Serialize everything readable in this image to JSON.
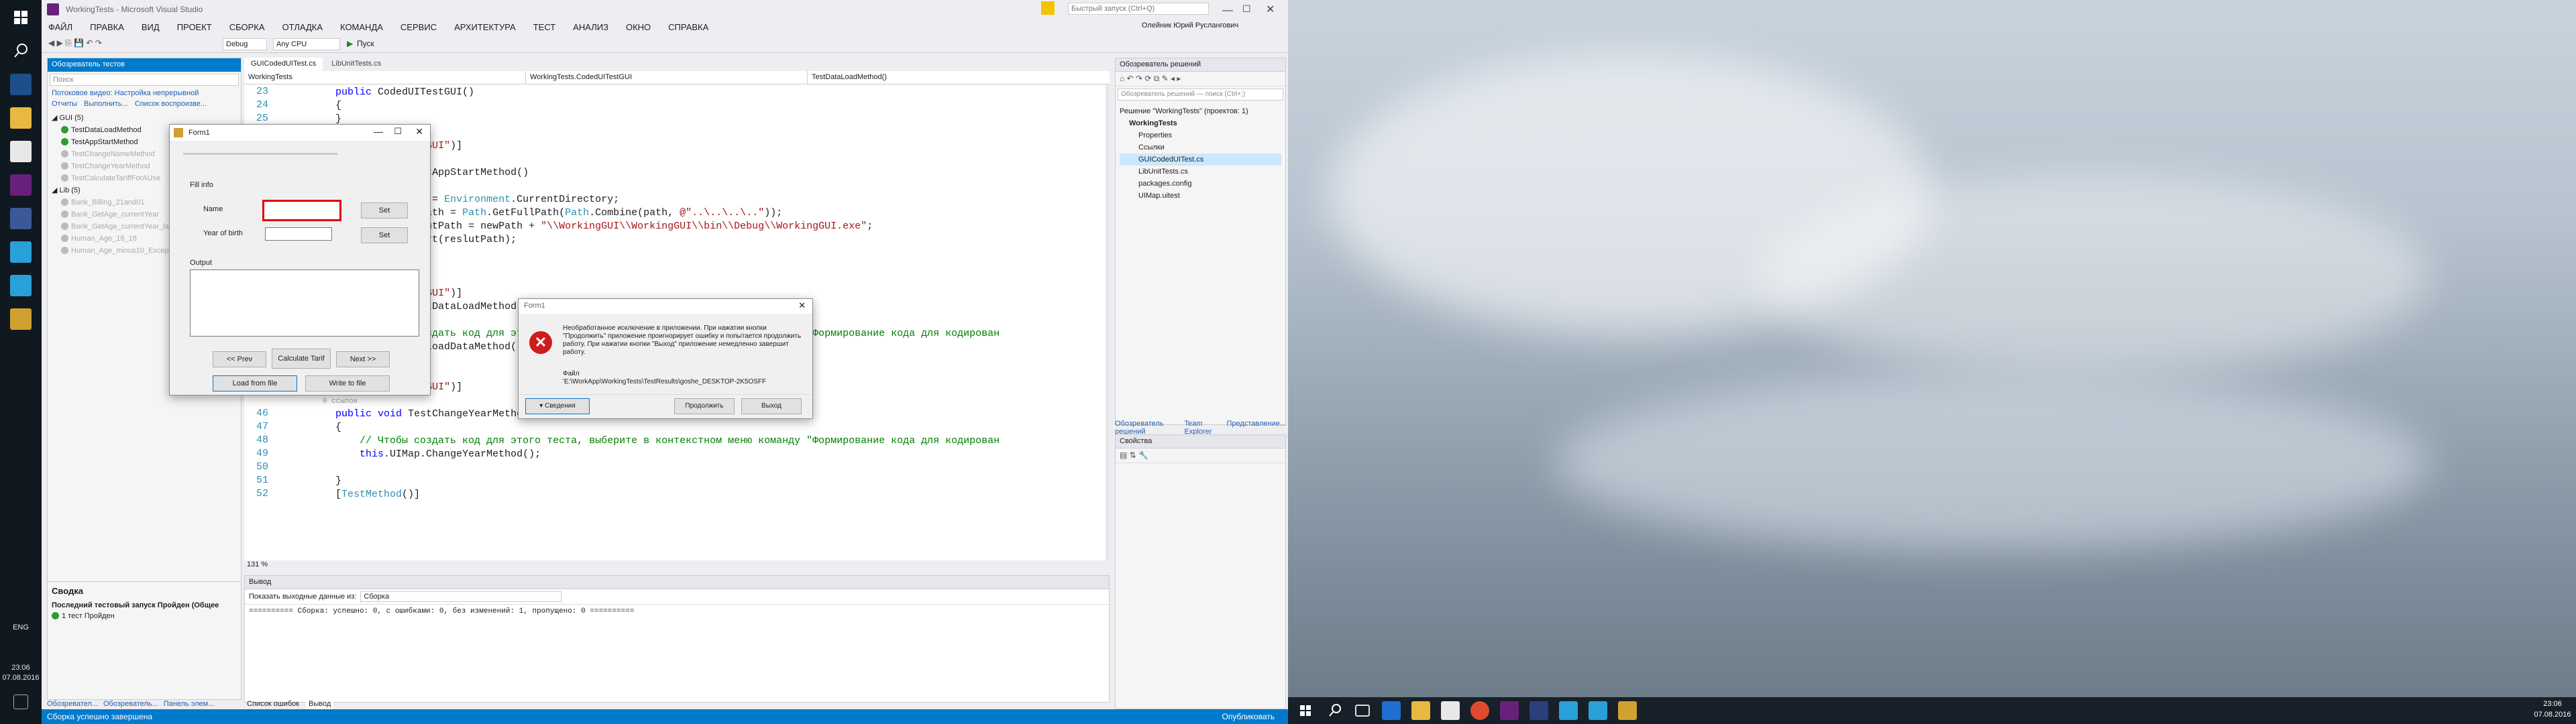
{
  "vs": {
    "title": "WorkingTests - Microsoft Visual Studio",
    "quick_launch_placeholder": "Быстрый запуск (Ctrl+Q)",
    "user": "Олейник Юрий Руслангович",
    "menu": [
      "ФАЙЛ",
      "ПРАВКА",
      "ВИД",
      "ПРОЕКТ",
      "СБОРКА",
      "ОТЛАДКА",
      "КОМАНДА",
      "СЕРВИС",
      "АРХИТЕКТУРА",
      "ТЕСТ",
      "АНАЛИЗ",
      "ОКНО",
      "СПРАВКА"
    ],
    "toolbar": {
      "config": "Debug",
      "platform": "Any CPU",
      "start": "Пуск"
    },
    "test_explorer": {
      "title": "Обозреватель тестов",
      "search_placeholder": "Поиск",
      "stream": "Потоковое видео: Настройка непрерывной",
      "group_label": "Отчеты",
      "run_label": "Выполнить...",
      "playlist_label": "Список воспроизве...",
      "groups": [
        {
          "name": "GUI (5)",
          "items": [
            "TestDataLoadMethod",
            "TestAppStartMethod",
            "TestChangeNameMethod",
            "TestChangeYearMethod",
            "TestCalculateTariffForAUse"
          ]
        },
        {
          "name": "Lib (5)",
          "items": [
            "Bank_Billing_21and01",
            "Bank_GetAge_currentYear",
            "Bank_GetAge_currentYear_la",
            "Human_Age_18_18",
            "Human_Age_minus10_Excep"
          ]
        }
      ],
      "summary_title": "Сводка",
      "summary_last": "Последний тестовый запуск Пройден (Общее",
      "summary_passed": "1 тест Пройден"
    },
    "tabs": [
      "GUICodedUITest.cs",
      "LibUnitTests.cs"
    ],
    "nav": {
      "project": "WorkingTests",
      "class": "WorkingTests.CodedUITestGUI",
      "member": "TestDataLoadMethod()"
    },
    "code": [
      {
        "n": "23",
        "t": "        public CodedUITestGUI()"
      },
      {
        "n": "24",
        "t": "        {"
      },
      {
        "n": "25",
        "t": "        }"
      },
      {
        "n": "",
        "t": "        [TestMethod()]"
      },
      {
        "n": "",
        "t": "        [TestCategory(\"GUI\")]"
      },
      {
        "n": "",
        "t": ""
      },
      {
        "n": "",
        "t": "        public void TestAppStartMethod()"
      },
      {
        "n": "",
        "t": "        {"
      },
      {
        "n": "",
        "t": "            string path = Environment.CurrentDirectory;"
      },
      {
        "n": "",
        "t": "            string newPath = Path.GetFullPath(Path.Combine(path, @\"..\\..\\..\\..\"));"
      },
      {
        "n": "",
        "t": "            string reslutPath = newPath + \"\\\\WorkingGUI\\\\WorkingGUI\\\\bin\\\\Debug\\\\WorkingGUI.exe\";"
      },
      {
        "n": "",
        "t": "            Process.Start(reslutPath);"
      },
      {
        "n": "",
        "t": "        }"
      },
      {
        "n": "",
        "t": ""
      },
      {
        "n": "",
        "t": "        [TestMethod()]"
      },
      {
        "n": "",
        "t": "        [TestCategory(\"GUI\")]"
      },
      {
        "n": "",
        "t": "        public void TestDataLoadMethod()"
      },
      {
        "n": "",
        "t": "        {"
      },
      {
        "n": "",
        "t": "            // Чтобы создать код для этого теста, выберите в контекстном меню команду \"Формирование кода для кодирован"
      },
      {
        "n": "42",
        "t": "            this.UIMap.LoadDataMethod();"
      },
      {
        "n": "43",
        "t": "        }"
      },
      {
        "n": "44",
        "t": "        [TestMethod()]"
      },
      {
        "n": "45",
        "t": "        [TestCategory(\"GUI\")]"
      },
      {
        "n": "",
        "t": "        0 ссылок"
      },
      {
        "n": "46",
        "t": "        public void TestChangeYearMethod()"
      },
      {
        "n": "47",
        "t": "        {"
      },
      {
        "n": "48",
        "t": "            // Чтобы создать код для этого теста, выберите в контекстном меню команду \"Формирование кода для кодирован"
      },
      {
        "n": "49",
        "t": "            this.UIMap.ChangeYearMethod();"
      },
      {
        "n": "50",
        "t": ""
      },
      {
        "n": "51",
        "t": "        }"
      },
      {
        "n": "52",
        "t": "        [TestMethod()]"
      }
    ],
    "zoom": "131 %",
    "output": {
      "title": "Вывод",
      "show_label": "Показать выходные данные из:",
      "source": "Сборка",
      "text": "========== Сборка: успешно: 0, с ошибками: 0, без изменений: 1, пропущено: 0 =========="
    },
    "bottom_tabs": [
      "Список ошибок",
      "Вывод"
    ],
    "left_bottom_tabs": [
      "Обозревател...",
      "Обозреватель...",
      "Панель элем..."
    ],
    "solution": {
      "title": "Обозреватель решений",
      "search_placeholder": "Обозреватель решений — поиск (Ctrl+;)",
      "items": [
        {
          "d": 0,
          "t": "Решение \"WorkingTests\" (проектов: 1)"
        },
        {
          "d": 1,
          "t": "WorkingTests"
        },
        {
          "d": 2,
          "t": "Properties"
        },
        {
          "d": 2,
          "t": "Ссылки"
        },
        {
          "d": 2,
          "t": "GUICodedUITest.cs"
        },
        {
          "d": 2,
          "t": "LibUnitTests.cs"
        },
        {
          "d": 2,
          "t": "packages.config"
        },
        {
          "d": 2,
          "t": "UIMap.uitest"
        }
      ],
      "tabs": [
        "Обозреватель решений",
        "Team Explorer",
        "Представление..."
      ]
    },
    "properties_title": "Свойства",
    "status_left": "Сборка успешно завершена",
    "status_right": "Опубликовать"
  },
  "form1": {
    "title": "Form1",
    "fill_info": "Fill info",
    "name_label": "Name",
    "year_label": "Year of birth",
    "set1": "Set",
    "set2": "Set",
    "output_label": "Output",
    "prev": "<< Prev",
    "calc": "Calculate Tarif",
    "next": "Next >>",
    "load": "Load from file",
    "write": "Write to file"
  },
  "error_dialog": {
    "title": "Form1",
    "message": "Необработанное исключение в приложении. При нажатии кнопки \"Продолжить\" приложение проигнорирует ошибку и попытается продолжить работу. При нажатии кнопки \"Выход\" приложение немедленно завершит работу.",
    "file_label": "Файл",
    "file_path": "'E:\\WorkApp\\WorkingTests\\TestResults\\goshe_DESKTOP-2K5OSFF",
    "details": "Сведения",
    "continue": "Продолжить",
    "exit": "Выход"
  },
  "taskbar_left": {
    "lang": "ENG",
    "time": "23:06",
    "date": "07.08.2016"
  },
  "taskbar_right": {
    "time": "23:06",
    "date": "07.08.2016"
  }
}
